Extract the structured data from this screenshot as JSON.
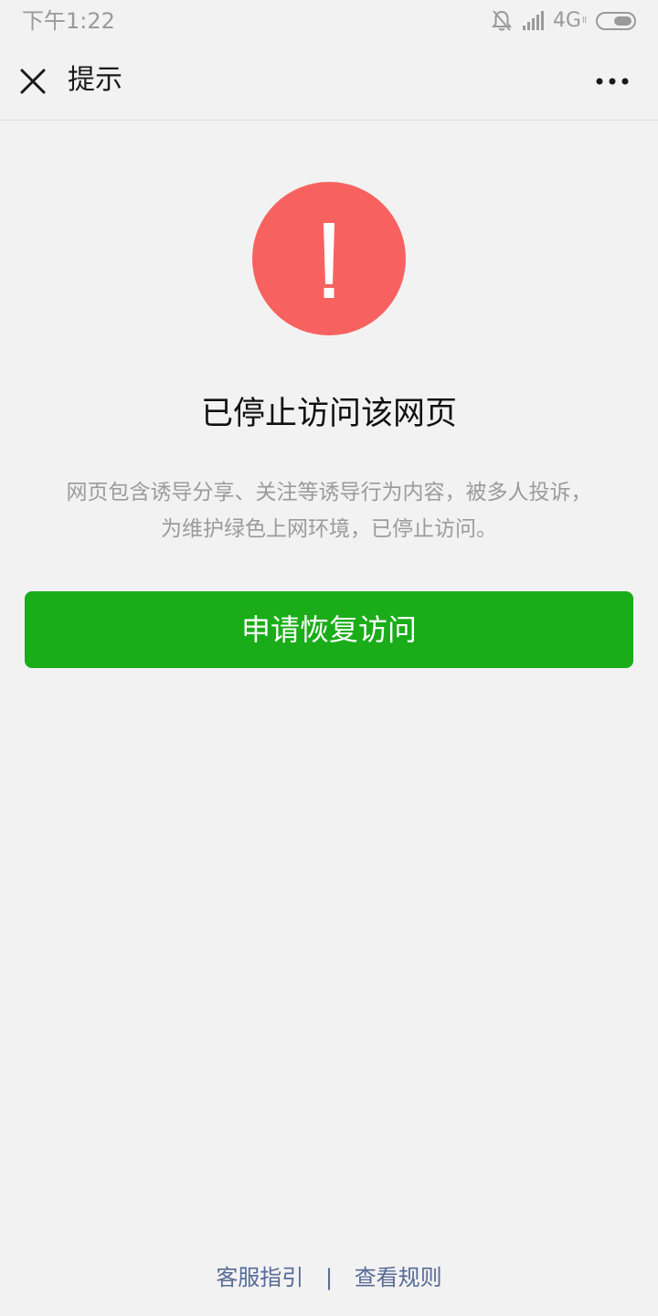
{
  "status_bar": {
    "time": "下午1:22",
    "network": "4G",
    "network_sub": "ll",
    "icons": [
      "mute-bell-icon",
      "signal-icon",
      "battery-icon"
    ]
  },
  "nav": {
    "title": "提示",
    "close_icon": "close-icon",
    "more_icon": "more-icon"
  },
  "warning": {
    "icon": "warning-icon",
    "color": "#f76260"
  },
  "main": {
    "heading": "已停止访问该网页",
    "description_line1": "网页包含诱导分享、关注等诱导行为内容，被多人投诉，",
    "description_line2": "为维护绿色上网环境，已停止访问。",
    "button_label": "申请恢复访问",
    "button_color": "#1aad19"
  },
  "footer": {
    "link_support": "客服指引",
    "separator": "|",
    "link_rules": "查看规则",
    "link_color": "#576b95"
  }
}
